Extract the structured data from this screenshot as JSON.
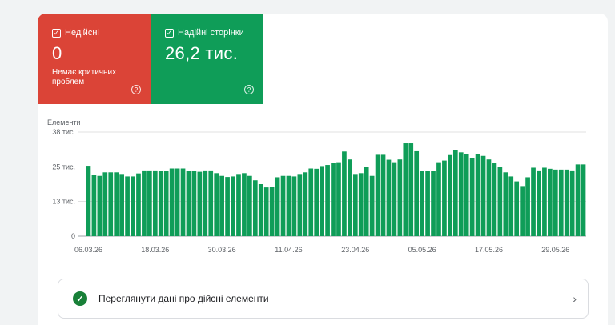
{
  "tiles": {
    "invalid": {
      "label": "Недійсні",
      "count": "0",
      "note": "Немає критичних проблем",
      "help": "?",
      "checked": "✓"
    },
    "valid": {
      "label": "Надійні сторінки",
      "count": "26,2 тис.",
      "help": "?",
      "checked": "✓"
    }
  },
  "colors": {
    "invalid": "#db4437",
    "valid": "#0f9d58",
    "bar": "#0f9d58"
  },
  "chart_data": {
    "type": "bar",
    "ylabel": "Елементи",
    "yticks": [
      {
        "value": 0,
        "label": "0"
      },
      {
        "value": 12.7,
        "label": "13 тис."
      },
      {
        "value": 25.3,
        "label": "25 тис."
      },
      {
        "value": 38,
        "label": "38 тис."
      }
    ],
    "ylim": [
      0,
      38
    ],
    "xtick_labels": [
      "06.03.26",
      "18.03.26",
      "30.03.26",
      "11.04.26",
      "23.04.26",
      "05.05.26",
      "17.05.26",
      "29.05.26"
    ],
    "xtick_indices": [
      0,
      12,
      24,
      36,
      48,
      60,
      72,
      84
    ],
    "grid": true,
    "values": [
      25.7,
      22.3,
      22.0,
      23.3,
      23.3,
      23.3,
      22.7,
      21.8,
      21.8,
      22.9,
      24.0,
      24.0,
      24.0,
      23.8,
      23.8,
      24.7,
      24.7,
      24.7,
      23.8,
      23.8,
      23.5,
      24.0,
      24.0,
      23.0,
      22.0,
      21.6,
      21.8,
      22.7,
      23.0,
      22.0,
      20.4,
      19.0,
      17.8,
      18.0,
      21.5,
      22.0,
      22.0,
      21.8,
      22.7,
      23.3,
      24.7,
      24.6,
      25.6,
      26.0,
      26.6,
      27.0,
      30.9,
      28.0,
      22.7,
      23.0,
      25.3,
      22.0,
      29.7,
      29.7,
      27.9,
      27.0,
      28.0,
      33.9,
      33.9,
      31.0,
      23.8,
      23.8,
      23.8,
      27.0,
      27.6,
      29.6,
      31.3,
      30.6,
      29.9,
      28.6,
      29.9,
      29.3,
      28.0,
      26.6,
      25.3,
      23.3,
      21.8,
      20.0,
      18.3,
      21.5,
      25.0,
      24.0,
      25.0,
      24.6,
      24.3,
      24.3,
      24.3,
      24.0,
      26.2,
      26.2
    ]
  },
  "link": {
    "label": "Переглянути дані про дійсні елементи",
    "chevron": "›"
  }
}
